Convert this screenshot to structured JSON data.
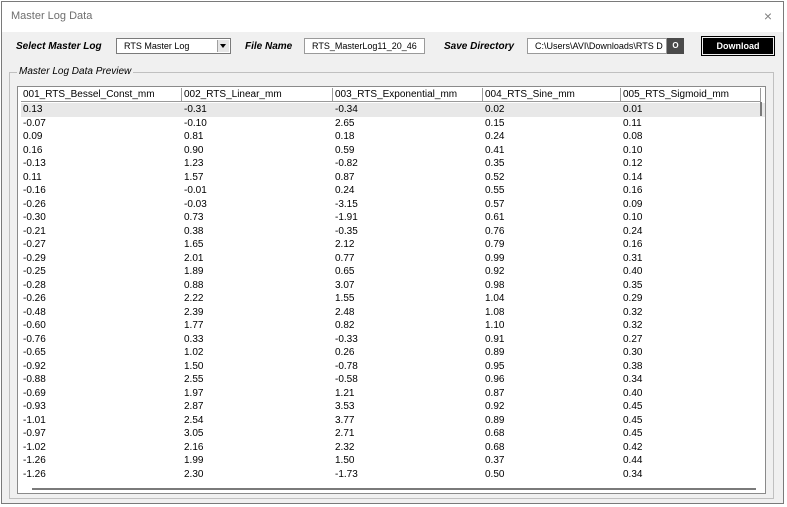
{
  "window": {
    "title": "Master Log Data",
    "close_icon": "×"
  },
  "controls": {
    "master_log_label": "Select Master Log",
    "master_log_value": "RTS Master Log",
    "file_name_label": "File Name",
    "file_name_value": "RTS_MasterLog11_20_46",
    "save_dir_label": "Save Directory",
    "save_dir_value": "C:\\Users\\AVI\\Downloads\\RTS D",
    "browse_label": "O",
    "download_label": "Download"
  },
  "preview": {
    "legend": "Master Log Data Preview",
    "columns": [
      "001_RTS_Bessel_Const_mm",
      "002_RTS_Linear_mm",
      "003_RTS_Exponential_mm",
      "004_RTS_Sine_mm",
      "005_RTS_Sigmoid_mm"
    ],
    "rows": [
      [
        "0.13",
        "-0.31",
        "-0.34",
        "0.02",
        "0.01"
      ],
      [
        "-0.07",
        "-0.10",
        "2.65",
        "0.15",
        "0.11"
      ],
      [
        "0.09",
        "0.81",
        "0.18",
        "0.24",
        "0.08"
      ],
      [
        "0.16",
        "0.90",
        "0.59",
        "0.41",
        "0.10"
      ],
      [
        "-0.13",
        "1.23",
        "-0.82",
        "0.35",
        "0.12"
      ],
      [
        "0.11",
        "1.57",
        "0.87",
        "0.52",
        "0.14"
      ],
      [
        "-0.16",
        "-0.01",
        "0.24",
        "0.55",
        "0.16"
      ],
      [
        "-0.26",
        "-0.03",
        "-3.15",
        "0.57",
        "0.09"
      ],
      [
        "-0.30",
        "0.73",
        "-1.91",
        "0.61",
        "0.10"
      ],
      [
        "-0.21",
        "0.38",
        "-0.35",
        "0.76",
        "0.24"
      ],
      [
        "-0.27",
        "1.65",
        "2.12",
        "0.79",
        "0.16"
      ],
      [
        "-0.29",
        "2.01",
        "0.77",
        "0.99",
        "0.31"
      ],
      [
        "-0.25",
        "1.89",
        "0.65",
        "0.92",
        "0.40"
      ],
      [
        "-0.28",
        "0.88",
        "3.07",
        "0.98",
        "0.35"
      ],
      [
        "-0.26",
        "2.22",
        "1.55",
        "1.04",
        "0.29"
      ],
      [
        "-0.48",
        "2.39",
        "2.48",
        "1.08",
        "0.32"
      ],
      [
        "-0.60",
        "1.77",
        "0.82",
        "1.10",
        "0.32"
      ],
      [
        "-0.76",
        "0.33",
        "-0.33",
        "0.91",
        "0.27"
      ],
      [
        "-0.65",
        "1.02",
        "0.26",
        "0.89",
        "0.30"
      ],
      [
        "-0.92",
        "1.50",
        "-0.78",
        "0.95",
        "0.38"
      ],
      [
        "-0.88",
        "2.55",
        "-0.58",
        "0.96",
        "0.34"
      ],
      [
        "-0.69",
        "1.97",
        "1.21",
        "0.87",
        "0.40"
      ],
      [
        "-0.93",
        "2.87",
        "3.53",
        "0.92",
        "0.45"
      ],
      [
        "-1.01",
        "2.54",
        "3.77",
        "0.89",
        "0.45"
      ],
      [
        "-0.97",
        "3.05",
        "2.71",
        "0.68",
        "0.45"
      ],
      [
        "-1.02",
        "2.16",
        "2.32",
        "0.68",
        "0.42"
      ],
      [
        "-1.26",
        "1.99",
        "1.50",
        "0.37",
        "0.44"
      ],
      [
        "-1.26",
        "2.30",
        "-1.73",
        "0.50",
        "0.34"
      ]
    ]
  }
}
